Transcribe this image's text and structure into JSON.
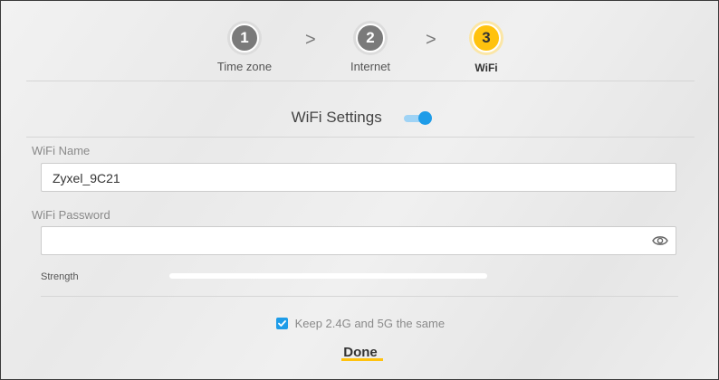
{
  "steps": [
    {
      "number": "1",
      "label": "Time zone",
      "active": false
    },
    {
      "number": "2",
      "label": "Internet",
      "active": false
    },
    {
      "number": "3",
      "label": "WiFi",
      "active": true
    }
  ],
  "separator": ">",
  "wifi_settings": {
    "title": "WiFi Settings",
    "enabled": true
  },
  "wifi_name": {
    "label": "WiFi Name",
    "value": "Zyxel_9C21"
  },
  "wifi_password": {
    "label": "WiFi Password",
    "value": ""
  },
  "strength": {
    "label": "Strength"
  },
  "keep_same": {
    "label": "Keep 2.4G and 5G the same",
    "checked": true
  },
  "done_label": "Done",
  "colors": {
    "accent_yellow": "#ffc20e",
    "toggle_blue": "#1e9ce8",
    "step_inactive": "#7a7a7a"
  },
  "icons": {
    "password_visibility": "eye-icon",
    "checkbox": "check-icon"
  }
}
